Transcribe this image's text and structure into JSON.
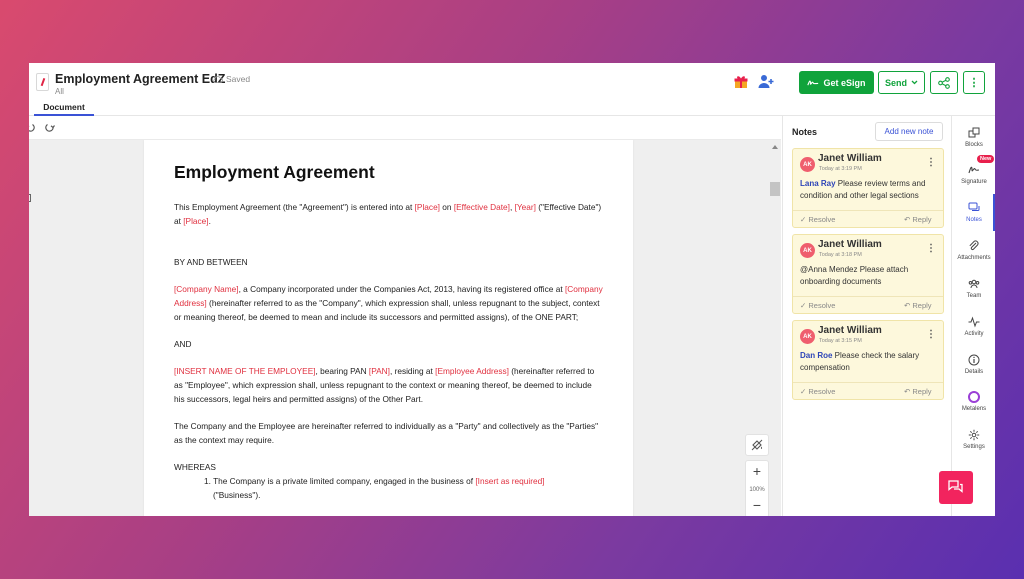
{
  "header": {
    "title": "Employment Agreement EdZ",
    "subtitle": "All",
    "saved_label": "Saved",
    "tab_document": "Document",
    "get_esign_label": "Get eSign",
    "send_label": "Send",
    "accent_color": "#10a33b"
  },
  "document": {
    "title": "Employment Agreement",
    "intro": {
      "t1": "This Employment Agreement (the \"Agreement\") is entered into at ",
      "p1": "[Place]",
      "t2": " on ",
      "p2": "[Effective Date]",
      "t3": ", ",
      "p3": "[Year]",
      "t4": " (\"Effective Date\") at ",
      "p4": "[Place]",
      "t5": "."
    },
    "between": "BY AND BETWEEN",
    "company": {
      "p1": "[Company Name]",
      "t1": ", a Company incorporated under the Companies Act, 2013, having its registered office at ",
      "p2": "[Company Address]",
      "t2": " (hereinafter referred to as the \"Company\", which expression shall, unless repugnant to the subject, context or meaning thereof, be deemed to mean and include its successors and permitted assigns), of the ONE PART;"
    },
    "and": "AND",
    "employee": {
      "p1": "[INSERT NAME OF THE EMPLOYEE]",
      "t1": ", bearing PAN ",
      "p2": "[PAN]",
      "t2": ", residing at ",
      "p3": "[Employee Address]",
      "t3": " (hereinafter referred to as \"Employee\", which expression shall, unless repugnant to the context or meaning thereof, be deemed to include his successors, legal heirs and permitted assigns) of the Other Part."
    },
    "parties": "The Company and the Employee are hereinafter referred to individually as a \"Party\" and collectively as the \"Parties\" as the context may require.",
    "whereas": "WHEREAS",
    "item1": {
      "t1": "1. The Company is a private limited company, engaged in the business of ",
      "p1": "[Insert as required]",
      "t2": "(\"Business\")."
    },
    "placeholder_color": "#e0303f"
  },
  "zoom": {
    "level": "100%"
  },
  "notes": {
    "title": "Notes",
    "add_label": "Add new note",
    "items": [
      {
        "initials": "AK",
        "author": "Janet William",
        "time": "Today at 3:19 PM",
        "mention": "Lana Ray",
        "text": " Please review terms and condition and other legal sections",
        "resolve": "Resolve",
        "reply": "Reply"
      },
      {
        "initials": "AK",
        "author": "Janet William",
        "time": "Today at 3:18 PM",
        "mention": "",
        "text": "@Anna Mendez Please attach onboarding documents",
        "resolve": "Resolve",
        "reply": "Reply"
      },
      {
        "initials": "AK",
        "author": "Janet William",
        "time": "Today at 3:15 PM",
        "mention": "Dan Roe",
        "text": " Please check the salary compensation",
        "resolve": "Resolve",
        "reply": "Reply"
      }
    ]
  },
  "rail": {
    "items": [
      {
        "label": "Blocks"
      },
      {
        "label": "Signature",
        "badge": "New"
      },
      {
        "label": "Notes"
      },
      {
        "label": "Attachments"
      },
      {
        "label": "Team"
      },
      {
        "label": "Activity"
      },
      {
        "label": "Details"
      },
      {
        "label": "Metalens"
      },
      {
        "label": "Settings"
      }
    ]
  }
}
